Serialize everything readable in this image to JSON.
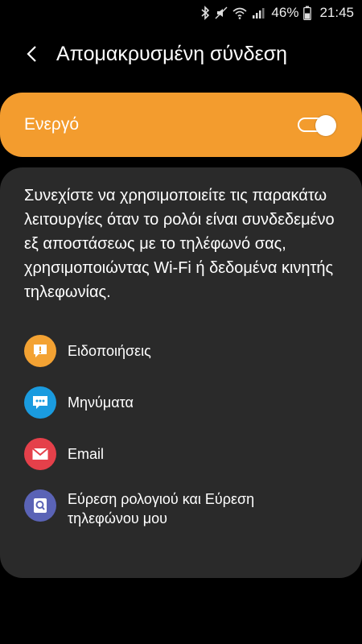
{
  "status_bar": {
    "battery_percent": "46%",
    "time": "21:45"
  },
  "header": {
    "title": "Απομακρυσμένη σύνδεση"
  },
  "toggle": {
    "label": "Ενεργό",
    "state": "on"
  },
  "card": {
    "description": "Συνεχίστε να χρησιμοποιείτε τις παρακάτω λειτουργίες όταν το ρολόι είναι συνδεδεμένο εξ αποστάσεως με το τηλέφωνό σας, χρησιμοποιώντας Wi-Fi ή δεδομένα κινητής τηλεφωνίας.",
    "features": [
      {
        "label": "Ειδοποιήσεις",
        "icon": "alert-icon",
        "color": "#F3A233"
      },
      {
        "label": "Μηνύματα",
        "icon": "chat-bubble-icon",
        "color": "#1A9BDF"
      },
      {
        "label": "Email",
        "icon": "envelope-icon",
        "color": "#E5404A"
      },
      {
        "label": "Εύρεση ρολογιού και Εύρεση τηλεφώνου μου",
        "icon": "find-search-icon",
        "color": "#5A63B6"
      }
    ]
  },
  "colors": {
    "accent": "#F39C2E",
    "card_bg": "#2A2A2A",
    "background": "#000000"
  }
}
